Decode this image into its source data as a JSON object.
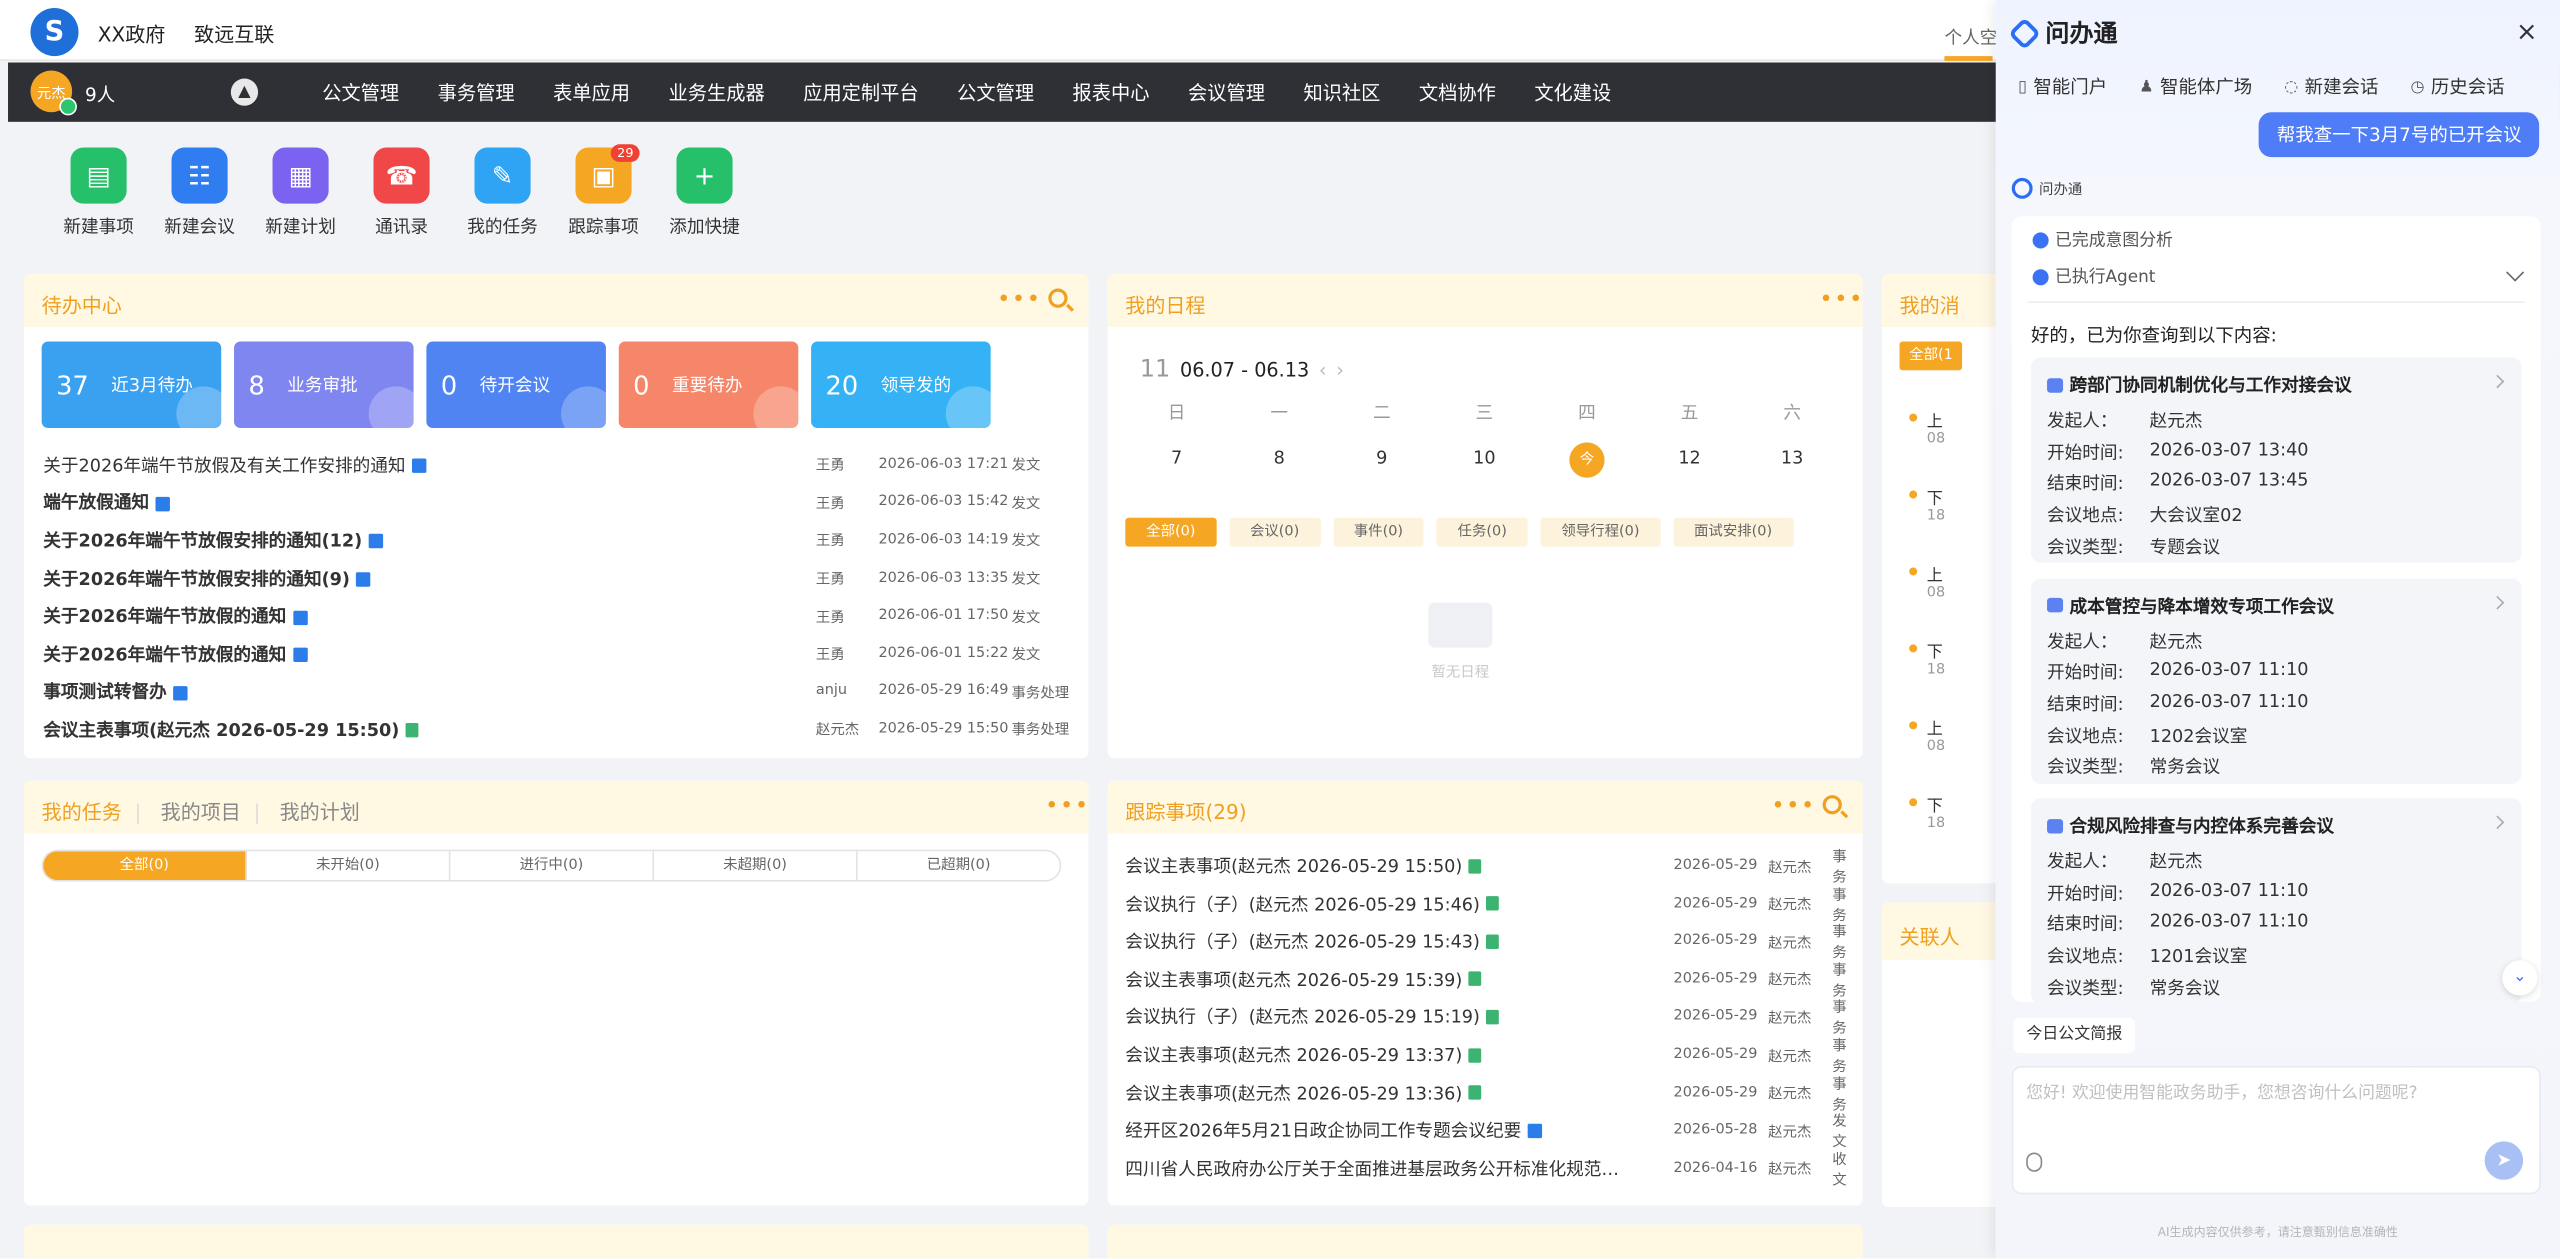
{
  "header": {
    "org": "XX政府",
    "product": "致远互联",
    "personal": "个人空"
  },
  "nav": {
    "avatar_text": "元杰",
    "people": "9人",
    "items": [
      "公文管理",
      "事务管理",
      "表单应用",
      "业务生成器",
      "应用定制平台",
      "公文管理",
      "报表中心",
      "会议管理",
      "知识社区",
      "文档协作",
      "文化建设"
    ]
  },
  "quick": {
    "items": [
      {
        "label": "新建事项",
        "color": "#27c06a",
        "icon": "▤"
      },
      {
        "label": "新建会议",
        "color": "#2f7df0",
        "icon": "☷"
      },
      {
        "label": "新建计划",
        "color": "#7b62f0",
        "icon": "▦"
      },
      {
        "label": "通讯录",
        "color": "#f04848",
        "icon": "☎"
      },
      {
        "label": "我的任务",
        "color": "#2fa4f5",
        "icon": "✎"
      },
      {
        "label": "跟踪事项",
        "color": "#f5a623",
        "icon": "▣",
        "badge": "29"
      },
      {
        "label": "添加快捷",
        "color": "#27c06a",
        "icon": "+"
      }
    ]
  },
  "todo": {
    "title": "待办中心",
    "stats": [
      {
        "num": "37",
        "label": "近3月待办",
        "color": "#3aa0f0"
      },
      {
        "num": "8",
        "label": "业务审批",
        "color": "#7f86f0"
      },
      {
        "num": "0",
        "label": "待开会议",
        "color": "#4f84f2"
      },
      {
        "num": "0",
        "label": "重要待办",
        "color": "#f6866a"
      },
      {
        "num": "20",
        "label": "领导发的",
        "color": "#35b2f5"
      }
    ],
    "rows": [
      {
        "title": "关于2026年端午节放假及有关工作安排的通知",
        "who": "王勇",
        "when": "2026-06-03 17:21",
        "kind": "发文",
        "bold": false,
        "doc": "w"
      },
      {
        "title": "端午放假通知",
        "who": "王勇",
        "when": "2026-06-03 15:42",
        "kind": "发文",
        "bold": true,
        "doc": "w"
      },
      {
        "title": "关于2026年端午节放假安排的通知(12)",
        "who": "王勇",
        "when": "2026-06-03 14:19",
        "kind": "发文",
        "bold": true,
        "doc": "w"
      },
      {
        "title": "关于2026年端午节放假安排的通知(9)",
        "who": "王勇",
        "when": "2026-06-03 13:35",
        "kind": "发文",
        "bold": true,
        "doc": "w"
      },
      {
        "title": "关于2026年端午节放假的通知",
        "who": "王勇",
        "when": "2026-06-01 17:50",
        "kind": "发文",
        "bold": true,
        "doc": "w"
      },
      {
        "title": "关于2026年端午节放假的通知",
        "who": "王勇",
        "when": "2026-06-01 15:22",
        "kind": "发文",
        "bold": true,
        "doc": "w"
      },
      {
        "title": "事项测试转督办",
        "who": "anju",
        "when": "2026-05-29 16:49",
        "kind": "事务处理",
        "bold": true,
        "doc": "w"
      },
      {
        "title": "会议主表事项(赵元杰 2026-05-29 15:50)",
        "who": "赵元杰",
        "when": "2026-05-29 15:50",
        "kind": "事务处理",
        "bold": true,
        "doc": "g"
      }
    ]
  },
  "schedule": {
    "title": "我的日程",
    "month": "11",
    "range": "06.07 - 06.13",
    "weekdays": [
      "日",
      "一",
      "二",
      "三",
      "四",
      "五",
      "六"
    ],
    "days": [
      "7",
      "8",
      "9",
      "10",
      "今",
      "12",
      "13"
    ],
    "filters": [
      "全部(0)",
      "会议(0)",
      "事件(0)",
      "任务(0)",
      "领导行程(0)",
      "面试安排(0)"
    ],
    "empty": "暂无日程"
  },
  "messages": {
    "title": "我的消",
    "tag": "全部(1",
    "items": [
      {
        "t": "上",
        "s": "08"
      },
      {
        "t": "下",
        "s": "18"
      },
      {
        "t": "上",
        "s": "08"
      },
      {
        "t": "下",
        "s": "18"
      },
      {
        "t": "上",
        "s": "08"
      },
      {
        "t": "下",
        "s": "18"
      }
    ]
  },
  "related": {
    "title": "关联人"
  },
  "tasks": {
    "tabs": [
      "我的任务",
      "我的项目",
      "我的计划"
    ],
    "segments": [
      "全部(0)",
      "未开始(0)",
      "进行中(0)",
      "未超期(0)",
      "已超期(0)"
    ]
  },
  "follow": {
    "title": "跟踪事项(29)",
    "rows": [
      {
        "title": "会议主表事项(赵元杰 2026-05-29 15:50)",
        "date": "2026-05-29",
        "who": "赵元杰",
        "kind": "事务",
        "doc": "g"
      },
      {
        "title": "会议执行（子）(赵元杰 2026-05-29 15:46)",
        "date": "2026-05-29",
        "who": "赵元杰",
        "kind": "事务",
        "doc": "g"
      },
      {
        "title": "会议执行（子）(赵元杰 2026-05-29 15:43)",
        "date": "2026-05-29",
        "who": "赵元杰",
        "kind": "事务",
        "doc": "g"
      },
      {
        "title": "会议主表事项(赵元杰 2026-05-29 15:39)",
        "date": "2026-05-29",
        "who": "赵元杰",
        "kind": "事务",
        "doc": "g"
      },
      {
        "title": "会议执行（子）(赵元杰 2026-05-29 15:19)",
        "date": "2026-05-29",
        "who": "赵元杰",
        "kind": "事务",
        "doc": "g"
      },
      {
        "title": "会议主表事项(赵元杰 2026-05-29 13:37)",
        "date": "2026-05-29",
        "who": "赵元杰",
        "kind": "事务",
        "doc": "g"
      },
      {
        "title": "会议主表事项(赵元杰 2026-05-29 13:36)",
        "date": "2026-05-29",
        "who": "赵元杰",
        "kind": "事务",
        "doc": "g"
      },
      {
        "title": "经开区2026年5月21日政企协同工作专题会议纪要",
        "date": "2026-05-28",
        "who": "赵元杰",
        "kind": "发文",
        "doc": "w"
      },
      {
        "title": "四川省人民政府办公厅关于全面推进基层政务公开标准化规范化...",
        "date": "2026-04-16",
        "who": "赵元杰",
        "kind": "收文",
        "doc": ""
      }
    ]
  },
  "assistant": {
    "name": "问办通",
    "close": "×",
    "tabs": [
      {
        "icon": "▯",
        "label": "智能门户"
      },
      {
        "icon": "♟",
        "label": "智能体广场"
      },
      {
        "icon": "◌",
        "label": "新建会话"
      },
      {
        "icon": "◷",
        "label": "历史会话"
      }
    ],
    "user_message": "帮我查一下3月7号的已开会议",
    "bot_name": "问办通",
    "steps": [
      "已完成意图分析",
      "已执行Agent"
    ],
    "intro": "好的，已为你查询到以下内容:",
    "labels": {
      "sponsor": "发起人：",
      "start": "开始时间:",
      "end": "结束时间:",
      "place": "会议地点:",
      "type": "会议类型:"
    },
    "meetings": [
      {
        "title": "跨部门协同机制优化与工作对接会议",
        "sponsor": "赵元杰",
        "start": "2026-03-07 13:40",
        "end": "2026-03-07 13:45",
        "place": "大会议室02",
        "type": "专题会议"
      },
      {
        "title": "成本管控与降本增效专项工作会议",
        "sponsor": "赵元杰",
        "start": "2026-03-07 11:10",
        "end": "2026-03-07 11:10",
        "place": "1202会议室",
        "type": "常务会议"
      },
      {
        "title": "合规风险排查与内控体系完善会议",
        "sponsor": "赵元杰",
        "start": "2026-03-07 11:10",
        "end": "2026-03-07 11:10",
        "place": "1201会议室",
        "type": "常务会议"
      }
    ],
    "brief": "今日公文简报",
    "placeholder": "您好! 欢迎使用智能政务助手，您想咨询什么问题呢?",
    "disclaimer": "AI生成内容仅供参考，请注意甄别信息准确性"
  }
}
